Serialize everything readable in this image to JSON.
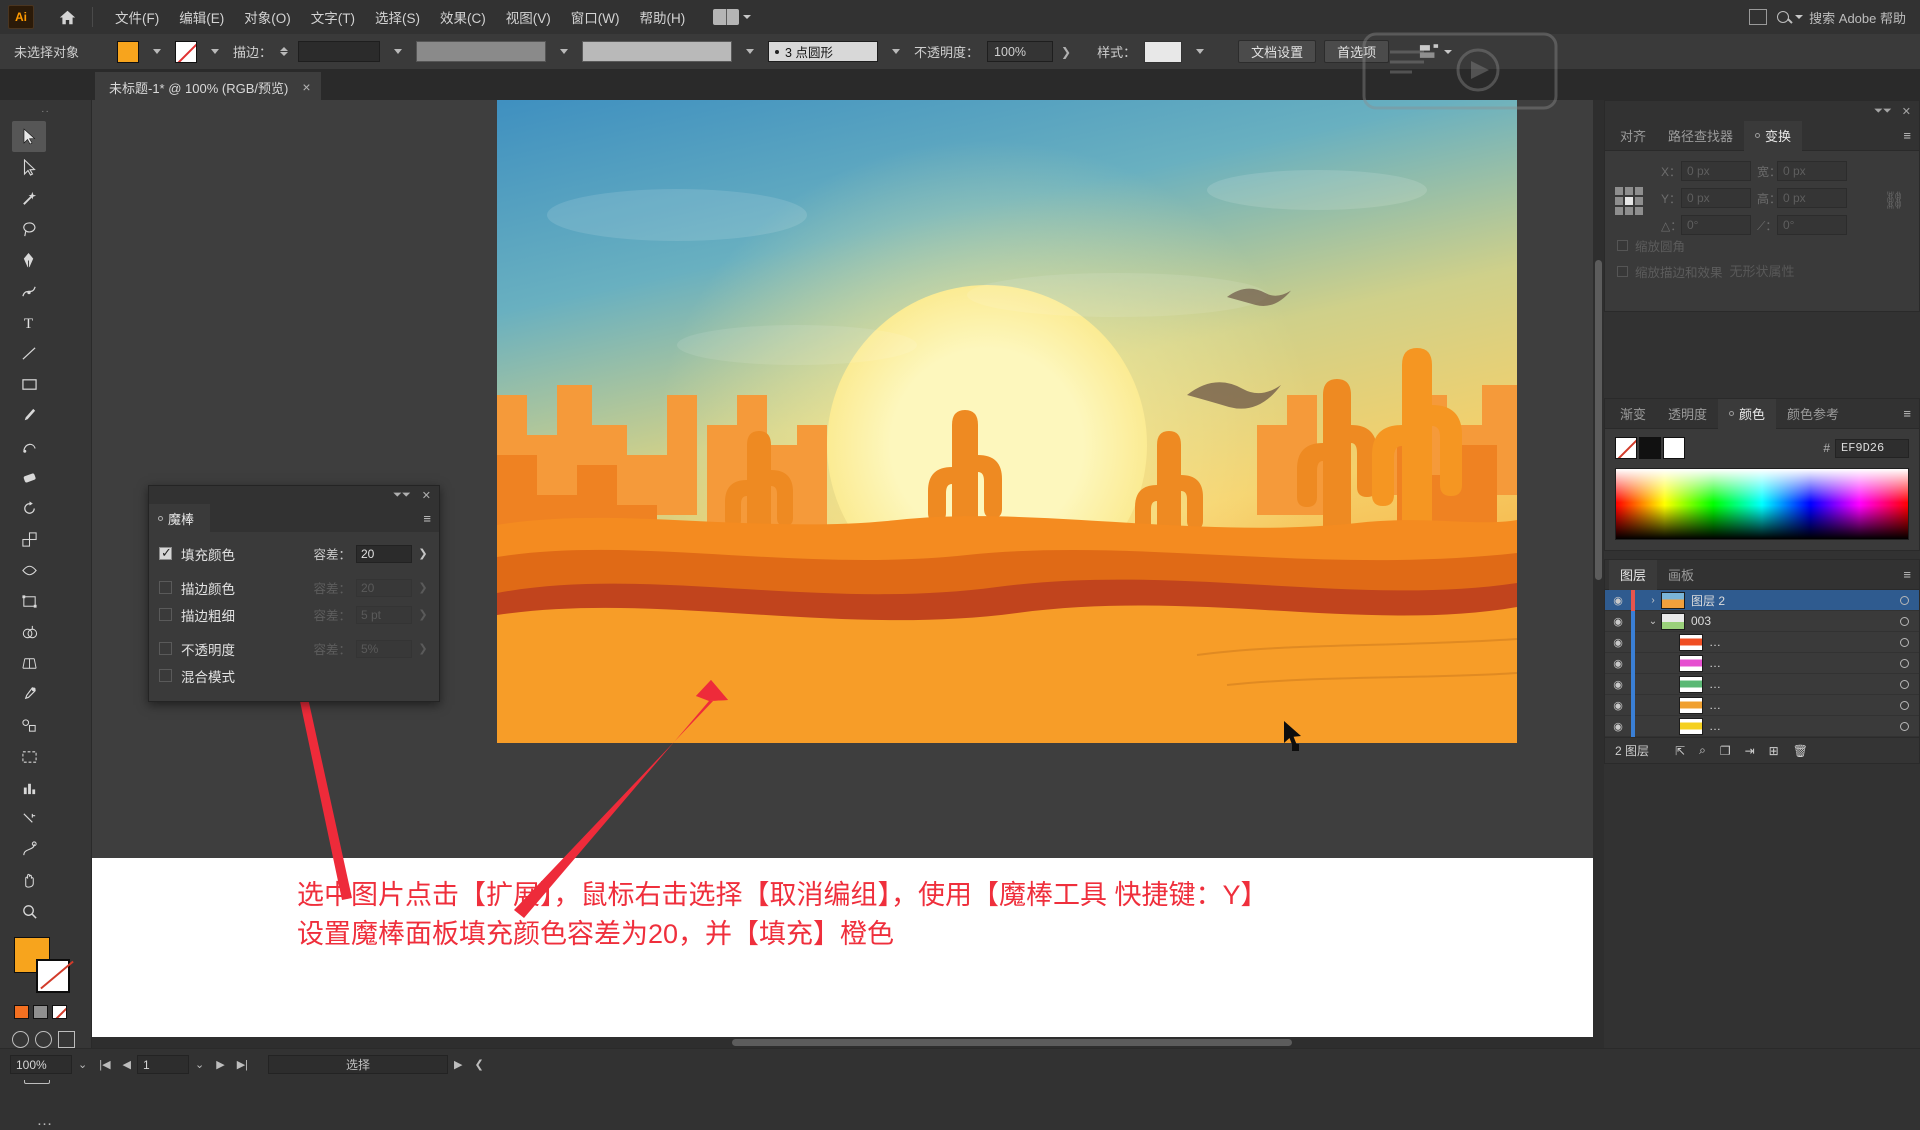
{
  "app": {
    "logo": "Ai",
    "home_icon": "home-icon"
  },
  "menu": {
    "items": [
      {
        "label": "文件(F)"
      },
      {
        "label": "编辑(E)"
      },
      {
        "label": "对象(O)"
      },
      {
        "label": "文字(T)"
      },
      {
        "label": "选择(S)"
      },
      {
        "label": "效果(C)"
      },
      {
        "label": "视图(V)"
      },
      {
        "label": "窗口(W)"
      },
      {
        "label": "帮助(H)"
      }
    ],
    "search_placeholder": "搜索 Adobe 帮助"
  },
  "control_bar": {
    "selection_status": "未选择对象",
    "fill_color": "#F7A41D",
    "stroke_label": "描边：",
    "stroke_weight": "",
    "stroke_profile": "3 点圆形",
    "opacity_label": "不透明度：",
    "opacity_value": "100%",
    "style_label": "样式：",
    "doc_setup_button": "文档设置",
    "preferences_button": "首选项"
  },
  "document_tab": {
    "title": "未标题-1* @ 100% (RGB/预览)",
    "close": "×"
  },
  "toolbar": {
    "tools": [
      "selection-tool",
      "direct-selection-tool",
      "magic-wand-tool",
      "lasso-tool",
      "pen-tool",
      "curvature-tool",
      "type-tool",
      "line-segment-tool",
      "rectangle-tool",
      "paintbrush-tool",
      "shaper-tool",
      "eraser-tool",
      "rotate-tool",
      "scale-tool",
      "width-tool",
      "free-transform-tool",
      "shape-builder-tool",
      "perspective-grid-tool",
      "eyedropper-tool",
      "blend-tool",
      "artboard-tool",
      "graph-tool",
      "slice-tool",
      "puppet-warp-tool",
      "hand-tool",
      "zoom-tool"
    ],
    "fill_color": "#F7A41D",
    "more_tools": "…"
  },
  "magic_wand_panel": {
    "title": "魔棒",
    "rows": [
      {
        "label": "填充颜色",
        "checked": true,
        "tolerance_label": "容差：",
        "tolerance_value": "20",
        "enabled": true
      },
      {
        "label": "描边颜色",
        "checked": false,
        "tolerance_label": "容差：",
        "tolerance_value": "20",
        "enabled": false
      },
      {
        "label": "描边粗细",
        "checked": false,
        "tolerance_label": "容差：",
        "tolerance_value": "5 pt",
        "enabled": false
      },
      {
        "label": "不透明度",
        "checked": false,
        "tolerance_label": "容差：",
        "tolerance_value": "5%",
        "enabled": false
      },
      {
        "label": "混合模式",
        "checked": false,
        "tolerance_label": "",
        "tolerance_value": "",
        "enabled": false
      }
    ]
  },
  "transform_panel": {
    "tabs": [
      {
        "label": "对齐",
        "active": false
      },
      {
        "label": "路径查找器",
        "active": false
      },
      {
        "label": "变换",
        "active": true
      }
    ],
    "fields": {
      "x_label": "X：",
      "x_value": "0 px",
      "y_label": "Y：",
      "y_value": "0 px",
      "w_label": "宽：",
      "w_value": "0 px",
      "h_label": "高：",
      "h_value": "0 px",
      "angle_label": "△：",
      "angle_value": "0°",
      "shear_label": "⟋：",
      "shear_value": "0°"
    },
    "checkboxes": [
      {
        "label": "缩放圆角"
      },
      {
        "label": "缩放描边和效果"
      }
    ],
    "no_attributes": "无形状属性"
  },
  "color_panel": {
    "tabs": [
      {
        "label": "渐变",
        "active": false
      },
      {
        "label": "透明度",
        "active": false
      },
      {
        "label": "颜色",
        "active": true
      },
      {
        "label": "颜色参考",
        "active": false
      }
    ],
    "hex_prefix": "#",
    "hex_value": "EF9D26"
  },
  "layers_panel": {
    "tabs": [
      {
        "label": "图层",
        "active": true
      },
      {
        "label": "画板",
        "active": false
      }
    ],
    "rows": [
      {
        "name": "图层 2",
        "selected": true,
        "indent": 0,
        "twisty": "›",
        "thumb_colors": [
          "#7ab4d8",
          "#f2a03c"
        ],
        "color_bar": "#e8554d"
      },
      {
        "name": "003",
        "selected": false,
        "indent": 1,
        "twisty": "⌄",
        "thumb_colors": [
          "#e8e8e8",
          "#9ad07a"
        ],
        "color_bar": "#3a7fd5"
      },
      {
        "name": "…",
        "selected": false,
        "indent": 2,
        "twisty": "",
        "thumb_colors": [
          "#f04e23",
          "#ffffff"
        ],
        "color_bar": "#3a7fd5"
      },
      {
        "name": "…",
        "selected": false,
        "indent": 2,
        "twisty": "",
        "thumb_colors": [
          "#e64fd0",
          "#ffffff"
        ],
        "color_bar": "#3a7fd5"
      },
      {
        "name": "…",
        "selected": false,
        "indent": 2,
        "twisty": "",
        "thumb_colors": [
          "#5ab874",
          "#ffffff"
        ],
        "color_bar": "#3a7fd5"
      },
      {
        "name": "…",
        "selected": false,
        "indent": 2,
        "twisty": "",
        "thumb_colors": [
          "#f0a030",
          "#ffffff"
        ],
        "color_bar": "#3a7fd5"
      },
      {
        "name": "…",
        "selected": false,
        "indent": 2,
        "twisty": "",
        "thumb_colors": [
          "#f5d020",
          "#ffffff"
        ],
        "color_bar": "#3a7fd5"
      }
    ],
    "footer_count": "2 图层",
    "footer_icons": [
      "locate-object-icon",
      "search-icon",
      "create-sublayer-icon",
      "make-clipping-mask-icon",
      "new-layer-icon",
      "delete-layer-icon"
    ]
  },
  "annotation": {
    "line1": "选中图片点击【扩展】，鼠标右击选择【取消编组】，使用【魔棒工具 快捷键：Y】",
    "line2": "设置魔棒面板填充颜色容差为20，并【填充】橙色",
    "color": "#EF2F3C"
  },
  "status_bar": {
    "zoom": "100%",
    "page_number": "1",
    "tool_name": "选择"
  },
  "artwork": {
    "description": "desert-sunset-illustration",
    "sky_top": "#4f9fc4",
    "sun_color": "#fdf4b0",
    "sand_color": "#f79d28",
    "cactus_color": "#f0841f",
    "rock_color": "#d95b14",
    "dark_dune": "#c1441d"
  }
}
